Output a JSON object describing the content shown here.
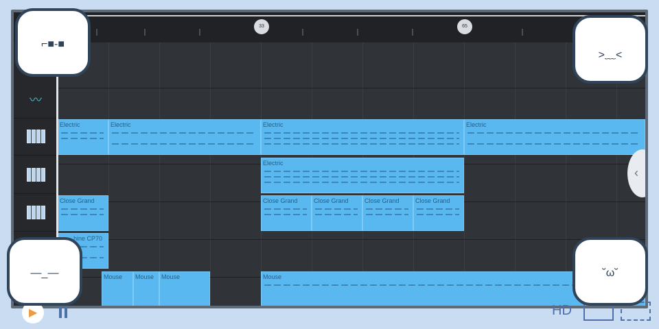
{
  "timeline": {
    "markers": [
      "33",
      "65"
    ]
  },
  "tracks": [
    {
      "icon": "waveform-icon"
    },
    {
      "icon": "piano-icon"
    },
    {
      "icon": "piano-icon"
    },
    {
      "icon": "piano-icon"
    },
    {
      "icon": "piano-icon"
    },
    {
      "icon": "piano-icon"
    }
  ],
  "clips": {
    "row1": [
      "Electric",
      "Electric",
      "Electric",
      "Electric"
    ],
    "row2": [
      "Electric"
    ],
    "row3": [
      "Close Grand",
      "Close Grand",
      "Close Grand",
      "Close Grand",
      "Close Grand"
    ],
    "row4": [
      "hine CP70"
    ],
    "row5": [
      "Mouse",
      "Mouse",
      "Mouse",
      "Mouse"
    ]
  },
  "player": {
    "hd_label": "HD"
  },
  "colors": {
    "clip": "#5ab8f1",
    "grid": "#303337",
    "accent": "#4d6faa"
  }
}
